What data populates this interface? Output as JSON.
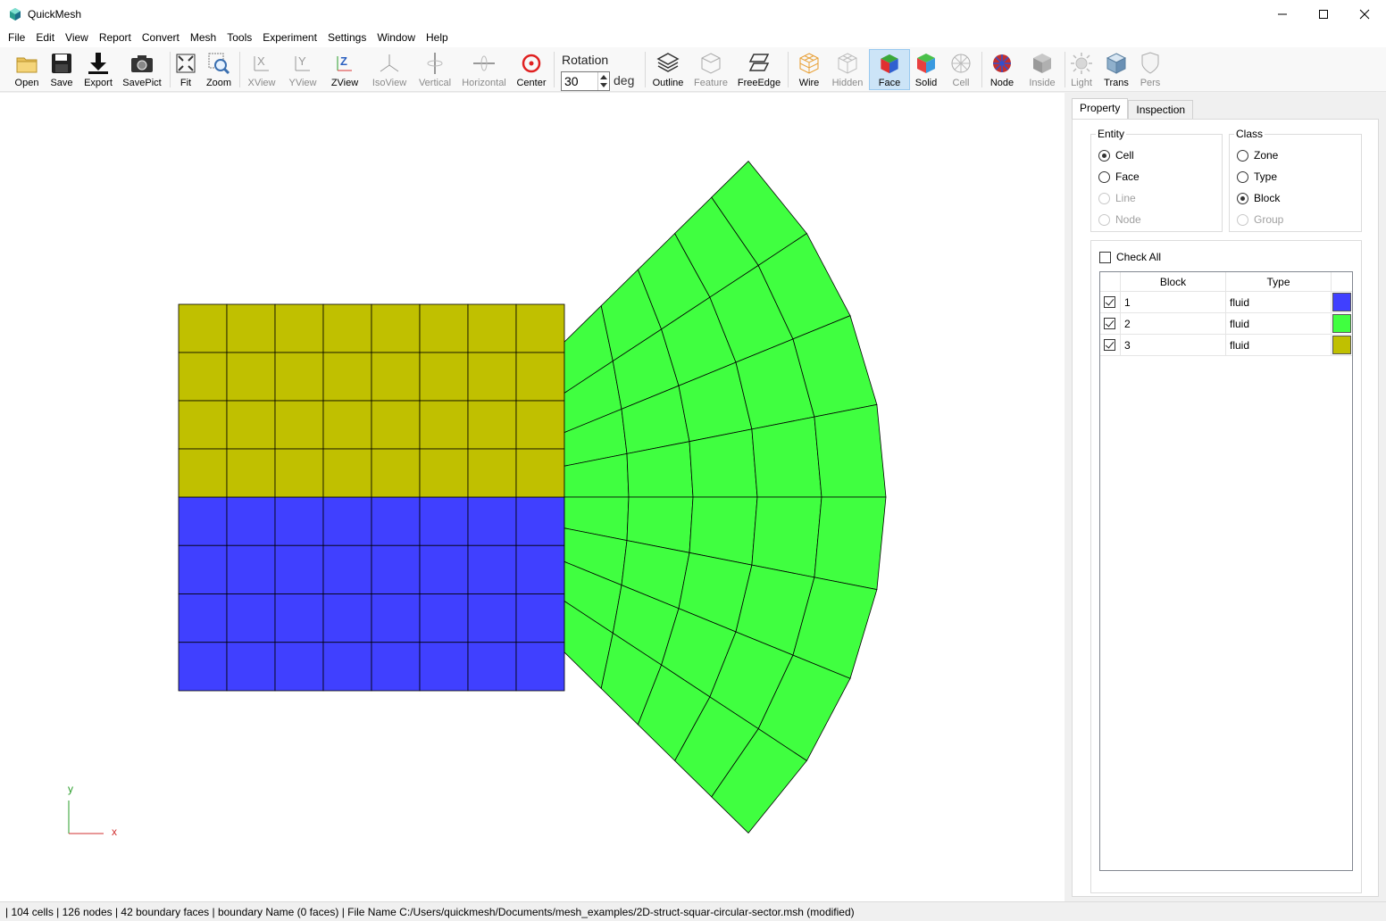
{
  "window": {
    "title": "QuickMesh"
  },
  "menu": [
    "File",
    "Edit",
    "View",
    "Report",
    "Convert",
    "Mesh",
    "Tools",
    "Experiment",
    "Settings",
    "Window",
    "Help"
  ],
  "toolbar": {
    "buttons": [
      {
        "label": "Open",
        "icon": "folder-icon",
        "enabled": true
      },
      {
        "label": "Save",
        "icon": "floppy-icon",
        "enabled": true
      },
      {
        "label": "Export",
        "icon": "download-icon",
        "enabled": true
      },
      {
        "label": "SavePict",
        "icon": "camera-icon",
        "enabled": true
      },
      {
        "label": "Fit",
        "icon": "fit-icon",
        "enabled": true
      },
      {
        "label": "Zoom",
        "icon": "zoom-icon",
        "enabled": true
      },
      {
        "label": "XView",
        "icon": "x-axis-view-icon",
        "enabled": false
      },
      {
        "label": "YView",
        "icon": "y-axis-view-icon",
        "enabled": false
      },
      {
        "label": "ZView",
        "icon": "z-axis-view-icon",
        "enabled": true
      },
      {
        "label": "IsoView",
        "icon": "iso-view-icon",
        "enabled": false
      },
      {
        "label": "Vertical",
        "icon": "vertical-rotate-icon",
        "enabled": false
      },
      {
        "label": "Horizontal",
        "icon": "horizontal-rotate-icon",
        "enabled": false
      },
      {
        "label": "Center",
        "icon": "center-target-icon",
        "enabled": true
      },
      {
        "label": "Outline",
        "icon": "outline-icon",
        "enabled": true
      },
      {
        "label": "Feature",
        "icon": "feature-cube-icon",
        "enabled": false
      },
      {
        "label": "FreeEdge",
        "icon": "free-edge-icon",
        "enabled": true
      },
      {
        "label": "Wire",
        "icon": "wire-cube-icon",
        "enabled": true
      },
      {
        "label": "Hidden",
        "icon": "hidden-cube-icon",
        "enabled": false
      },
      {
        "label": "Face",
        "icon": "face-cube-icon",
        "enabled": true,
        "active": true
      },
      {
        "label": "Solid",
        "icon": "solid-cube-icon",
        "enabled": true
      },
      {
        "label": "Cell",
        "icon": "cell-sphere-icon",
        "enabled": false
      },
      {
        "label": "Node",
        "icon": "node-sphere-icon",
        "enabled": true
      },
      {
        "label": "Inside",
        "icon": "inside-cube-icon",
        "enabled": false
      },
      {
        "label": "Light",
        "icon": "light-sun-icon",
        "enabled": false
      },
      {
        "label": "Trans",
        "icon": "trans-cube-icon",
        "enabled": true
      },
      {
        "label": "Pers",
        "icon": "pers-shield-icon",
        "enabled": false
      }
    ],
    "rotation": {
      "label": "Rotation",
      "value": "30",
      "unit": "deg"
    }
  },
  "viewport": {
    "axis": {
      "y_label": "y",
      "x_label": "x"
    },
    "colors": {
      "block1": "#4040ff",
      "block2": "#40ff40",
      "block3": "#c0c000",
      "background": "#ffffff"
    }
  },
  "panel": {
    "tabs": [
      {
        "label": "Property",
        "active": true
      },
      {
        "label": "Inspection",
        "active": false
      }
    ],
    "entity": {
      "title": "Entity",
      "options": [
        {
          "label": "Cell",
          "checked": true,
          "enabled": true
        },
        {
          "label": "Face",
          "checked": false,
          "enabled": true
        },
        {
          "label": "Line",
          "checked": false,
          "enabled": false
        },
        {
          "label": "Node",
          "checked": false,
          "enabled": false
        }
      ]
    },
    "class": {
      "title": "Class",
      "options": [
        {
          "label": "Zone",
          "checked": false,
          "enabled": true
        },
        {
          "label": "Type",
          "checked": false,
          "enabled": true
        },
        {
          "label": "Block",
          "checked": true,
          "enabled": true
        },
        {
          "label": "Group",
          "checked": false,
          "enabled": false
        }
      ]
    },
    "check_all": {
      "label": "Check All",
      "checked": false
    },
    "table": {
      "headers": [
        "Block",
        "Type"
      ],
      "rows": [
        {
          "checked": true,
          "block": "1",
          "type": "fluid",
          "color": "#4040ff"
        },
        {
          "checked": true,
          "block": "2",
          "type": "fluid",
          "color": "#40ff40"
        },
        {
          "checked": true,
          "block": "3",
          "type": "fluid",
          "color": "#c0c000"
        }
      ]
    }
  },
  "status": {
    "text": "| 104 cells | 126 nodes | 42 boundary faces |  boundary Name  (0 faces) | File Name C:/Users/quickmesh/Documents/mesh_examples/2D-struct-squar-circular-sector.msh (modified)"
  }
}
